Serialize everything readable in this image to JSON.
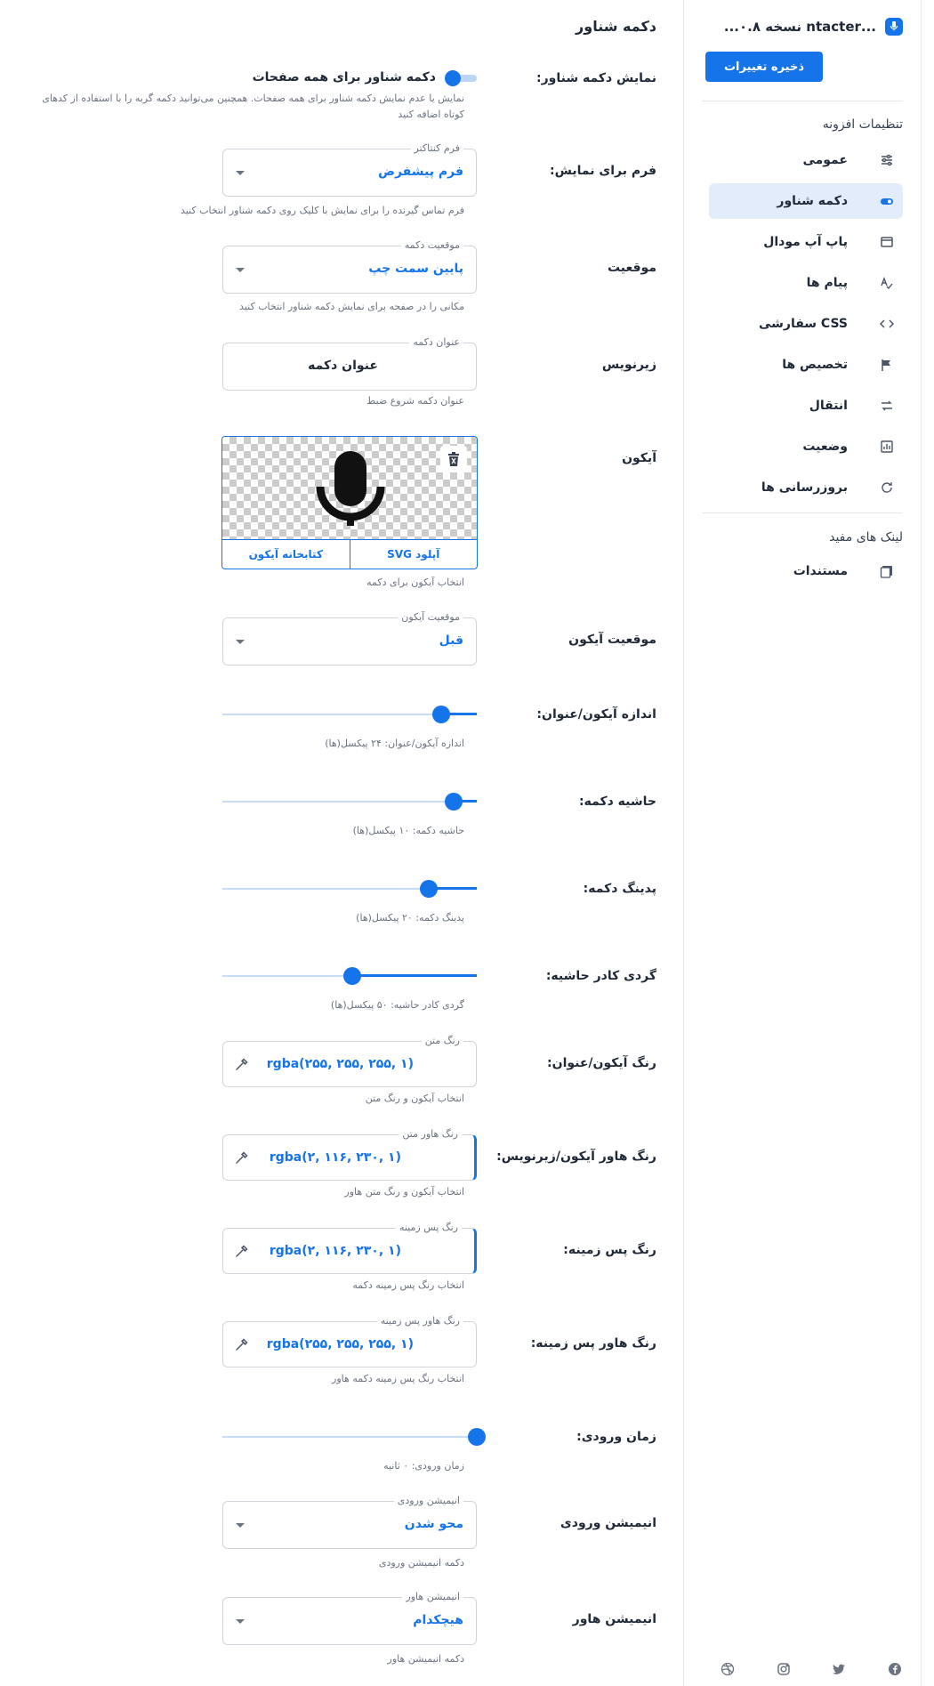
{
  "sidebar": {
    "brand": "...ntacter نسخه ۰.۸...",
    "save_label": "ذخیره تغییرات",
    "settings_title": "تنظیمات افزونه",
    "items": [
      {
        "label": "عمومی",
        "icon": "sliders-icon"
      },
      {
        "label": "دکمه شناور",
        "icon": "toggle-icon"
      },
      {
        "label": "پاپ آپ مودال",
        "icon": "window-icon"
      },
      {
        "label": "پیام ها",
        "icon": "spellcheck-icon"
      },
      {
        "label": "CSS سفارشی",
        "icon": "code-icon"
      },
      {
        "label": "تخصیص ها",
        "icon": "flag-icon"
      },
      {
        "label": "انتقال",
        "icon": "transfer-icon"
      },
      {
        "label": "وضعیت",
        "icon": "chart-icon"
      },
      {
        "label": "بروزرسانی ها",
        "icon": "refresh-icon"
      }
    ],
    "links_title": "لینک های مفید",
    "links": [
      {
        "label": "مستندات",
        "icon": "docs-icon"
      }
    ],
    "social": [
      "facebook-icon",
      "twitter-icon",
      "instagram-icon",
      "dribbble-icon"
    ]
  },
  "main": {
    "title": "دکمه شناور",
    "show_button": {
      "label": "نمایش دکمه شناور:",
      "toggle_label": "دکمه شناور برای همه صفحات",
      "enabled": true,
      "description": "نمایش یا عدم نمایش دکمه شناور برای همه صفحات. همچنین می‌توانید دکمه گربه را با استفاده از کدهای کوتاه اضافه کنید"
    },
    "form": {
      "label": "فرم برای نمایش:",
      "legend": "فرم کنتاکتر",
      "value": "فرم پیشفرض",
      "helper": "فرم تماس گیرنده را برای نمایش با کلیک روی دکمه شناور انتخاب کنید"
    },
    "position": {
      "label": "موقعیت",
      "legend": "موقعیت دکمه",
      "value": "پایین سمت چپ",
      "helper": "مکانی را در صفحه برای نمایش دکمه شناور انتخاب کنید"
    },
    "caption": {
      "label": "زیرنویس",
      "legend": "عنوان دکمه",
      "value": "عنوان دکمه",
      "helper": "عنوان دکمه شروع ضبط"
    },
    "icon": {
      "label": "آیکون",
      "upload_label": "آپلود SVG",
      "library_label": "کتابخانه آیکون",
      "helper": "انتخاب آیکون برای دکمه"
    },
    "icon_position": {
      "label": "موقعیت آیکون",
      "legend": "موقعیت آیکون",
      "value": "قبل"
    },
    "icon_size": {
      "label": "اندازه آیکون/عنوان:",
      "helper": "اندازه آیکون/عنوان: ۲۴ پیکسل(ها)",
      "fraction": 0.14
    },
    "margin": {
      "label": "حاشیه دکمه:",
      "helper": "حاشیه دکمه: ۱۰ پیکسل(ها)",
      "fraction": 0.09
    },
    "padding": {
      "label": "پدینگ دکمه:",
      "helper": "پدینگ دکمه: ۲۰ پیکسل(ها)",
      "fraction": 0.19
    },
    "radius": {
      "label": "گردی کادر حاشیه:",
      "helper": "گردی کادر حاشیه: ۵۰ پیکسل(ها)",
      "fraction": 0.49
    },
    "text_color": {
      "label": "رنگ آیکون/عنوان:",
      "legend": "رنگ متن",
      "value": "rgba(۲۵۵, ۲۵۵, ۲۵۵, ۱)",
      "helper": "انتخاب آیکون و رنگ متن"
    },
    "text_hover_color": {
      "label": "رنگ هاور آیکون/زیرنویس:",
      "legend": "رنگ هاور متن",
      "value": "rgba(۲, ۱۱۶, ۲۳۰, ۱)",
      "helper": "انتخاب آیکون و رنگ متن هاور"
    },
    "bg_color": {
      "label": "رنگ پس زمینه:",
      "legend": "رنگ پس زمینه",
      "value": "rgba(۲, ۱۱۶, ۲۳۰, ۱)",
      "helper": "انتخاب رنگ پس زمینه دکمه"
    },
    "bg_hover_color": {
      "label": "رنگ هاور پس زمینه:",
      "legend": "رنگ هاور پس زمینه",
      "value": "rgba(۲۵۵, ۲۵۵, ۲۵۵, ۱)",
      "helper": "انتخاب رنگ پس زمینه دکمه هاور"
    },
    "entry_time": {
      "label": "زمان ورودی:",
      "helper": "زمان ورودی: ۰ ثانیه",
      "fraction": 0.0
    },
    "entry_animation": {
      "label": "انیمیشن ورودی",
      "legend": "انیمیشن ورودی",
      "value": "محو شدن",
      "helper": "دکمه انیمیشن ورودی"
    },
    "hover_animation": {
      "label": "انیمیشن هاور",
      "legend": "انیمیشن هاور",
      "value": "هیچکدام",
      "helper": "دکمه انیمیشن هاور"
    }
  },
  "colors": {
    "accent": "#1574ea",
    "active_bg": "#e3ecfb"
  }
}
